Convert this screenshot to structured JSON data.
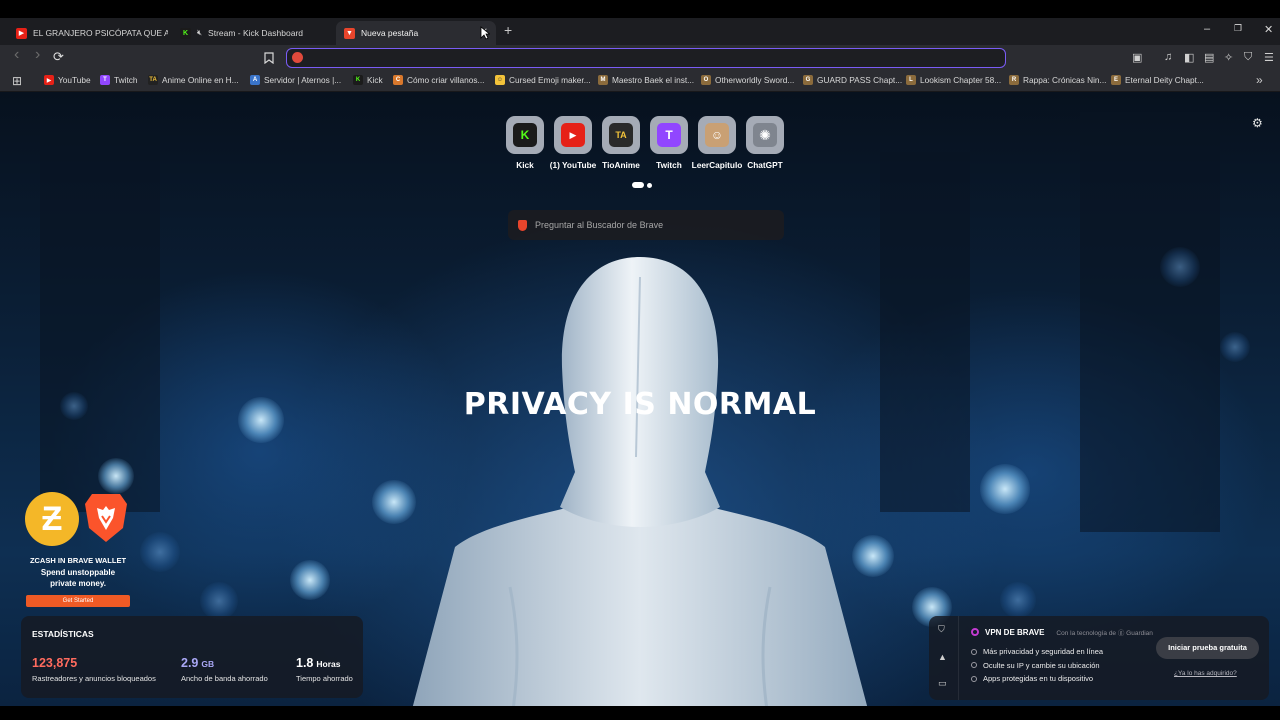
{
  "tabs": [
    {
      "label": "EL GRANJERO PSICÓPATA QUE ALIM",
      "icon": "youtube-icon",
      "color": "#e62117"
    },
    {
      "label": "Stream - Kick Dashboard",
      "icon": "kick-icon",
      "color": "#53fc18"
    },
    {
      "label": "Nueva pestaña",
      "icon": "brave-icon",
      "color": "#e8452c",
      "active": true
    }
  ],
  "new_tab_symbol": "+",
  "window_controls": {
    "minimize": "–",
    "restore": "❐",
    "close": "✕"
  },
  "toolbar": {
    "back": "‹",
    "forward": "›",
    "reload": "⟳",
    "bookmark": "☐",
    "address_value": ""
  },
  "bookmarks": [
    {
      "label": "YouTube",
      "icon_color": "#e62117",
      "glyph": "▶"
    },
    {
      "label": "Twitch",
      "icon_color": "#9146ff",
      "glyph": "T"
    },
    {
      "label": "Anime Online en H...",
      "icon_color": "#222222",
      "glyph": "TA"
    },
    {
      "label": "Servidor | Aternos |...",
      "icon_color": "#3a74c9",
      "glyph": "A"
    },
    {
      "label": "Kick",
      "icon_color": "#53fc18",
      "glyph": "K"
    },
    {
      "label": "Cómo criar villanos...",
      "icon_color": "#d9782c",
      "glyph": "C"
    },
    {
      "label": "Cursed Emoji maker...",
      "icon_color": "#f3c33a",
      "glyph": "☺"
    },
    {
      "label": "Maestro Baek el inst...",
      "icon_color": "#8b6b3c",
      "glyph": "M"
    },
    {
      "label": "Otherworldly Sword...",
      "icon_color": "#8b6b3c",
      "glyph": "O"
    },
    {
      "label": "GUARD PASS Chapt...",
      "icon_color": "#8b6b3c",
      "glyph": "G"
    },
    {
      "label": "Lookism Chapter 58...",
      "icon_color": "#8b6b3c",
      "glyph": "L"
    },
    {
      "label": "Rappa: Crónicas Nin...",
      "icon_color": "#8b6b3c",
      "glyph": "R"
    },
    {
      "label": "Eternal Deity Chapt...",
      "icon_color": "#8b6b3c",
      "glyph": "E"
    }
  ],
  "bookmarks_more": "»",
  "shortcuts": [
    {
      "label": "Kick",
      "glyph": "K",
      "bg": "#1b1b1b",
      "fg": "#53fc18"
    },
    {
      "label": "(1) YouTube",
      "glyph": "▶",
      "bg": "#e62117",
      "fg": "#ffffff"
    },
    {
      "label": "TioAnime",
      "glyph": "TA",
      "bg": "#2a2a2a",
      "fg": "#f3c33a"
    },
    {
      "label": "Twitch",
      "glyph": "T",
      "bg": "#9146ff",
      "fg": "#ffffff"
    },
    {
      "label": "LeerCapitulo",
      "glyph": "☺",
      "bg": "#c9a074",
      "fg": "#ffffff"
    },
    {
      "label": "ChatGPT",
      "glyph": "✺",
      "bg": "#7f858f",
      "fg": "#ffffff"
    }
  ],
  "search": {
    "placeholder": "Preguntar al Buscador de Brave"
  },
  "settings_icon": "⚙",
  "headline": "PRIVACY IS NORMAL",
  "promo": {
    "zcash_glyph": "Ƶ",
    "title": "ZCASH IN BRAVE WALLET",
    "line1": "Spend unstoppable",
    "line2": "private money.",
    "cta": "Get Started"
  },
  "stats": {
    "title": "ESTADÍSTICAS",
    "items": [
      {
        "value": "123,875",
        "unit": "",
        "desc": "Rastreadores y anuncios bloqueados",
        "color": "#ff6b5e"
      },
      {
        "value": "2.9",
        "unit": "GB",
        "desc": "Ancho de banda ahorrado",
        "color": "#a9a7f5"
      },
      {
        "value": "1.8",
        "unit": "Horas",
        "desc": "Tiempo ahorrado",
        "color": "#ffffff"
      }
    ]
  },
  "vpn": {
    "name": "VPN DE BRAVE",
    "powered": "Con la tecnología de ⓖ Guardian",
    "features": [
      "Más privacidad y seguridad en línea",
      "Oculte su IP y cambie su ubicación",
      "Apps protegidas en tu dispositivo"
    ],
    "button": "Iniciar prueba gratuita",
    "link": "¿Ya lo has adquirido?"
  }
}
